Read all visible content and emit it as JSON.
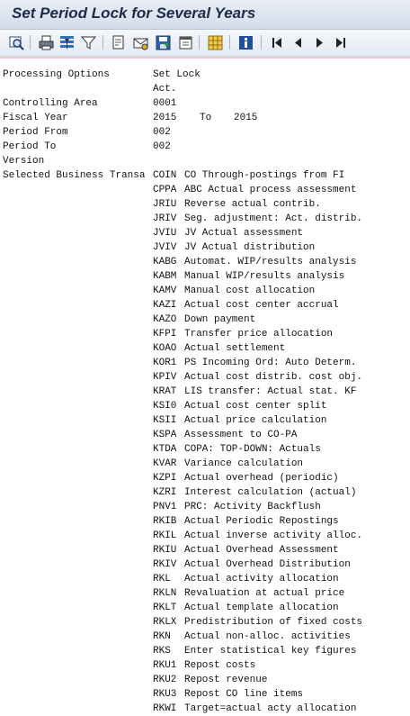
{
  "window": {
    "title": "Set Period Lock for Several Years"
  },
  "toolbar": {
    "icons": [
      "details-icon",
      "print-icon",
      "filter-icon",
      "filter-clear-icon",
      "export-icon",
      "mail-icon",
      "save-icon",
      "local-file-icon",
      "layout-icon",
      "info-icon",
      "first-page-icon",
      "previous-page-icon",
      "next-page-icon",
      "last-page-icon"
    ]
  },
  "report": {
    "processing_options": {
      "label": "Processing Options",
      "value": "Set Lock",
      "value2": "Act."
    },
    "controlling_area": {
      "label": "Controlling Area",
      "value": "0001"
    },
    "fiscal_year": {
      "label": "Fiscal Year",
      "from": "2015",
      "to_label": "To",
      "to": "2015"
    },
    "period_from": {
      "label": "Period From",
      "value": "002"
    },
    "period_to": {
      "label": "Period To",
      "value": "002"
    },
    "version": {
      "label": "Version",
      "value": ""
    },
    "business_transactions_label": "Selected Business Transa",
    "transactions": [
      {
        "code": "COIN",
        "desc": "CO Through-postings from FI"
      },
      {
        "code": "CPPA",
        "desc": "ABC Actual process assessment"
      },
      {
        "code": "JRIU",
        "desc": "Reverse actual contrib."
      },
      {
        "code": "JRIV",
        "desc": "Seg. adjustment: Act. distrib."
      },
      {
        "code": "JVIU",
        "desc": "JV Actual assessment"
      },
      {
        "code": "JVIV",
        "desc": "JV Actual distribution"
      },
      {
        "code": "KABG",
        "desc": "Automat. WIP/results analysis"
      },
      {
        "code": "KABM",
        "desc": "Manual WIP/results analysis"
      },
      {
        "code": "KAMV",
        "desc": "Manual cost allocation"
      },
      {
        "code": "KAZI",
        "desc": "Actual cost center accrual"
      },
      {
        "code": "KAZO",
        "desc": "Down payment"
      },
      {
        "code": "KFPI",
        "desc": "Transfer price allocation"
      },
      {
        "code": "KOAO",
        "desc": "Actual settlement"
      },
      {
        "code": "KOR1",
        "desc": "PS Incoming Ord: Auto Determ."
      },
      {
        "code": "KPIV",
        "desc": "Actual cost distrib. cost obj."
      },
      {
        "code": "KRAT",
        "desc": "LIS transfer: Actual stat. KF"
      },
      {
        "code": "KSI0",
        "desc": "Actual cost center split"
      },
      {
        "code": "KSII",
        "desc": "Actual price calculation"
      },
      {
        "code": "KSPA",
        "desc": "Assessment to CO-PA"
      },
      {
        "code": "KTDA",
        "desc": "COPA: TOP-DOWN: Actuals"
      },
      {
        "code": "KVAR",
        "desc": "Variance calculation"
      },
      {
        "code": "KZPI",
        "desc": "Actual overhead (periodic)"
      },
      {
        "code": "KZRI",
        "desc": "Interest calculation (actual)"
      },
      {
        "code": "PNV1",
        "desc": "PRC: Activity Backflush"
      },
      {
        "code": "RKIB",
        "desc": "Actual Periodic Repostings"
      },
      {
        "code": "RKIL",
        "desc": "Actual inverse activity alloc."
      },
      {
        "code": "RKIU",
        "desc": "Actual Overhead Assessment"
      },
      {
        "code": "RKIV",
        "desc": "Actual Overhead Distribution"
      },
      {
        "code": "RKL",
        "desc": "Actual activity allocation"
      },
      {
        "code": "RKLN",
        "desc": "Revaluation at actual price"
      },
      {
        "code": "RKLT",
        "desc": "Actual template allocation"
      },
      {
        "code": "RKLX",
        "desc": "Predistribution of fixed costs"
      },
      {
        "code": "RKN",
        "desc": "Actual non-alloc. activities"
      },
      {
        "code": "RKS",
        "desc": "Enter statistical key figures"
      },
      {
        "code": "RKU1",
        "desc": "Repost costs"
      },
      {
        "code": "RKU2",
        "desc": "Repost revenue"
      },
      {
        "code": "RKU3",
        "desc": "Repost CO line items"
      },
      {
        "code": "RKWI",
        "desc": "Target=actual acty allocation"
      }
    ]
  }
}
